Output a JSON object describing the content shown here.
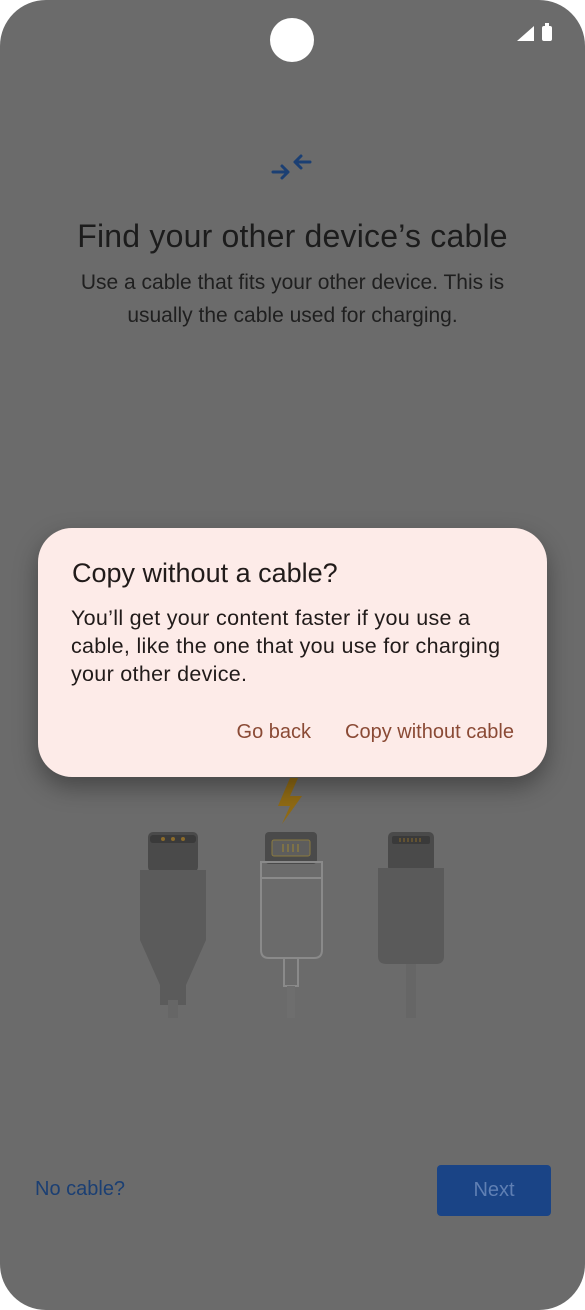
{
  "screen": {
    "title": "Find your other device’s cable",
    "subtitle": "Use a cable that fits your other device. This is usually the cable used for charging."
  },
  "icons": {
    "hero": "cable-connect-icon",
    "status_signal": "signal-icon",
    "status_battery": "battery-icon",
    "lightning": "lightning-bolt-icon"
  },
  "footer": {
    "no_cable_link": "No cable?",
    "next_button": "Next"
  },
  "dialog": {
    "title": "Copy without a cable?",
    "body": "You’ll get your content faster if you use a cable, like the one that you use for charging your other device.",
    "actions": {
      "go_back": "Go back",
      "copy_without_cable": "Copy without cable"
    }
  },
  "colors": {
    "scrim": "#6b6b6b",
    "dialog_bg": "#fdebe8",
    "accent_text": "#8a4a35",
    "primary": "#1a4486"
  }
}
